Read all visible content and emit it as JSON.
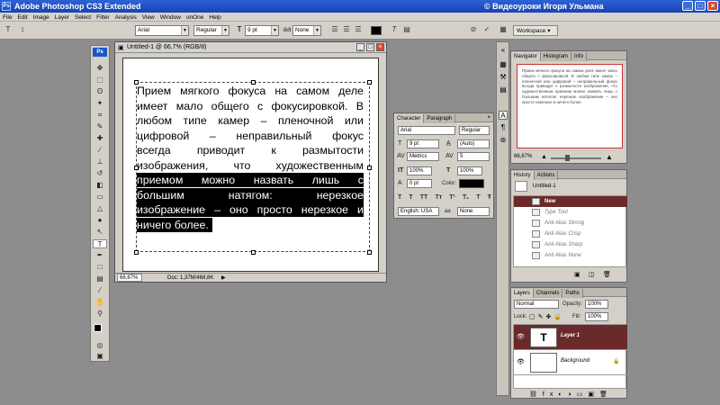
{
  "window": {
    "app_icon": "Ps",
    "title": "Adobe Photoshop CS3 Extended",
    "watermark": "© Видеоуроки Игоря Ульмана"
  },
  "menu": [
    "File",
    "Edit",
    "Image",
    "Layer",
    "Select",
    "Filter",
    "Analysis",
    "View",
    "Window",
    "onOne",
    "Help"
  ],
  "options": {
    "font_family": "Arial",
    "font_style": "Regular",
    "font_size": "9 pt",
    "antialias_label": "aa",
    "antialias": "None",
    "workspace": "Workspace ▾",
    "text_color": "#000000"
  },
  "document": {
    "title": "Untitled-1 @ 66,7% (RGB/8)",
    "zoom": "66,67%",
    "doc_size": "Doc: 1,37M/468,8K",
    "text_lines": [
      {
        "text": "Прием мягкого фокуса на самом деле",
        "selected": false
      },
      {
        "text": "имеет мало общего с фокусировкой. В",
        "selected": false
      },
      {
        "text": "любом типе камер – пленочной или",
        "selected": false
      },
      {
        "text": "цифровой – неправильный фокус",
        "selected": false
      },
      {
        "text": "всегда приводит к размытости",
        "selected": false
      },
      {
        "text": "изображения, что художественным",
        "selected": false
      },
      {
        "text": "приемом можно назвать лишь с",
        "selected": true
      },
      {
        "text": "большим натягом: нерезкое",
        "selected": true
      },
      {
        "text": "изображение – оно просто нерезкое и",
        "selected": true
      },
      {
        "text": "ничего более.",
        "selected": true,
        "last": true
      }
    ]
  },
  "character_panel": {
    "tab_character": "Character",
    "tab_paragraph": "Paragraph",
    "font": "Arial",
    "style": "Regular",
    "size": "9 pt",
    "leading": "(Auto)",
    "kerning": "Metrics",
    "tracking": "5",
    "vscale": "100%",
    "hscale": "100%",
    "baseline": "0 pt",
    "color_label": "Color:",
    "color": "#000000",
    "typo_buttons": [
      "T",
      "T",
      "TT",
      "Tт",
      "T¹",
      "T₁",
      "T",
      "Ŧ"
    ],
    "language": "English: USA",
    "aa_label": "aa",
    "antialias": "None"
  },
  "navigator": {
    "tabs": [
      "Navigator",
      "Histogram",
      "Info"
    ],
    "zoom": "66,67%"
  },
  "history": {
    "tabs": [
      "History",
      "Actions"
    ],
    "snapshot": "Untitled-1",
    "items": [
      {
        "label": "New",
        "active": true
      },
      {
        "label": "Type Tool",
        "active": false
      },
      {
        "label": "Anti Alias Strong",
        "active": false
      },
      {
        "label": "Anti Alias Crisp",
        "active": false
      },
      {
        "label": "Anti Alias Sharp",
        "active": false
      },
      {
        "label": "Anti Alias None",
        "active": false
      }
    ]
  },
  "layers": {
    "tabs": [
      "Layers",
      "Channels",
      "Paths"
    ],
    "blend_mode": "Normal",
    "opacity_label": "Opacity:",
    "opacity": "100%",
    "lock_label": "Lock:",
    "fill_label": "Fill:",
    "fill": "100%",
    "items": [
      {
        "name": "Layer 1",
        "type": "text",
        "thumb_text": "T",
        "active": true
      },
      {
        "name": "Background",
        "type": "bg",
        "active": false
      }
    ]
  },
  "colors": {
    "accent_dark_red": "#6b2a2a",
    "title_blue": "#2358cf",
    "workspace_gray": "#8d8d8d"
  }
}
